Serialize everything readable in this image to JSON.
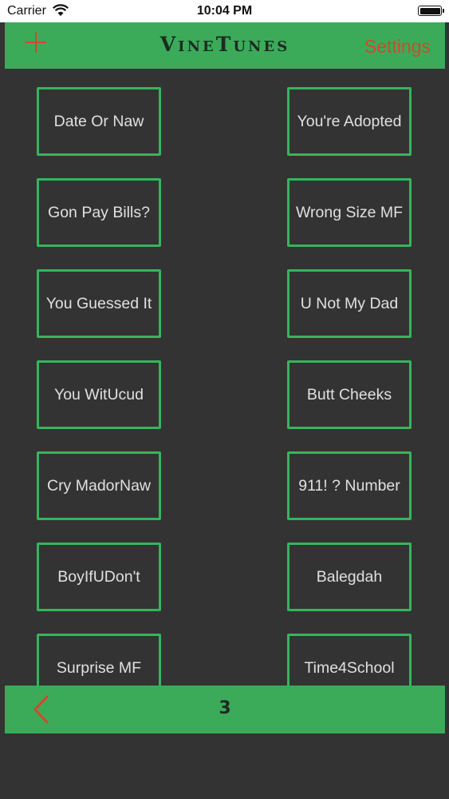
{
  "status": {
    "carrier": "Carrier",
    "time": "10:04 PM"
  },
  "navbar": {
    "add_icon": "plus-icon",
    "title": "VineTunes",
    "settings": "Settings"
  },
  "sounds": [
    [
      "Date Or Naw",
      "You're Adopted"
    ],
    [
      "Gon Pay Bills?",
      "Wrong Size MF"
    ],
    [
      "You Guessed It",
      "U Not My Dad"
    ],
    [
      "You WitUcud",
      "Butt Cheeks"
    ],
    [
      "Cry MadorNaw",
      "911! ? Number"
    ],
    [
      "BoyIfUDon't",
      "Balegdah"
    ],
    [
      "Surprise MF",
      "Time4School"
    ]
  ],
  "bottom": {
    "back_icon": "chevron-left-icon",
    "page": "3"
  },
  "colors": {
    "accent_green": "#3bab5a",
    "tile_border": "#35b55c",
    "accent_red": "#cf4a2a",
    "background": "#333333"
  }
}
